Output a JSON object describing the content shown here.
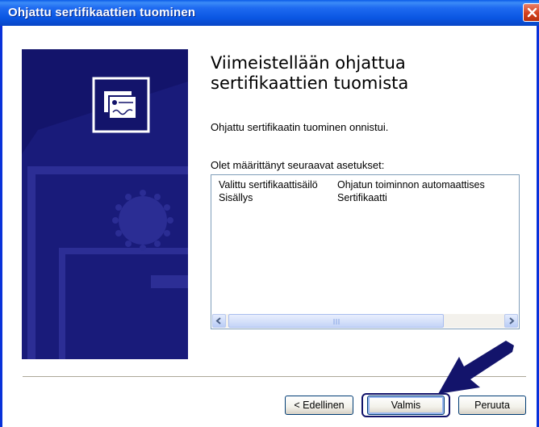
{
  "window": {
    "title": "Ohjattu sertifikaattien tuominen"
  },
  "heading": {
    "line1": "Viimeistellään ohjattua",
    "line2": "sertifikaattien tuomista"
  },
  "status_text": "Ohjattu sertifikaatin tuominen onnistui.",
  "settings_label": "Olet määrittänyt seuraavat asetukset:",
  "settings": [
    {
      "name": "Valittu sertifikaattisäilö",
      "value": "Ohjatun toiminnon automaattises"
    },
    {
      "name": "Sisällys",
      "value": "Sertifikaatti"
    }
  ],
  "buttons": {
    "back": "< Edellinen",
    "finish": "Valmis",
    "cancel": "Peruuta"
  },
  "icons": [
    "close-icon",
    "certificate-icon",
    "scroll-left-icon",
    "scroll-right-icon",
    "pointer-arrow-icon"
  ],
  "colors": {
    "titlebar": "#0a56e2",
    "banner": "#13146b",
    "arrow": "#13146b"
  }
}
